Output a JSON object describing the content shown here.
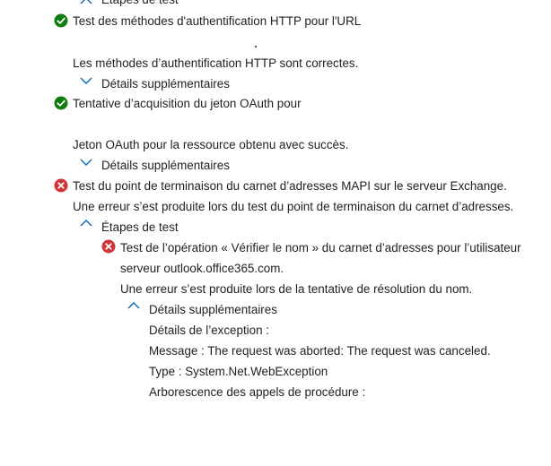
{
  "colors": {
    "success": "#107c10",
    "error": "#d13438",
    "chevron": "#0067c0",
    "text": "#1f1f1f"
  },
  "icons": {
    "success": "checkmark-circle-icon",
    "error": "error-circle-icon",
    "collapsed": "chevron-down-icon",
    "expanded": "chevron-up-icon"
  },
  "top": {
    "steps_label": "Étapes de test"
  },
  "tests": {
    "http_auth": {
      "title": "Test des méthodes d'authentification HTTP pour l'URL",
      "result": "Les méthodes d’authentification HTTP sont correctes.",
      "details_label": "Détails supplémentaires"
    },
    "oauth": {
      "title": "Tentative d’acquisition du jeton OAuth pour",
      "result": "Jeton OAuth pour la ressource obtenu avec succès.",
      "details_label": "Détails supplémentaires"
    },
    "mapi_ab": {
      "title": "Test du point de terminaison du carnet d’adresses MAPI sur le serveur Exchange.",
      "result": "Une erreur s’est produite lors du test du point de terminaison du carnet d’adresses.",
      "steps_label": "Étapes de test",
      "substep": {
        "title": "Test de l’opération « Vérifier le nom » du carnet d’adresses pour l’utilisateur",
        "title_line2": "serveur outlook.office365.com.",
        "result": "Une erreur s’est produite lors de la tentative de résolution du nom.",
        "details_label": "Détails supplémentaires",
        "exception_label": "Détails de l’exception :",
        "message": "Message : The request was aborted: The request was canceled.",
        "type": "Type : System.Net.WebException",
        "stack_label": "Arborescence des appels de procédure :"
      }
    }
  }
}
